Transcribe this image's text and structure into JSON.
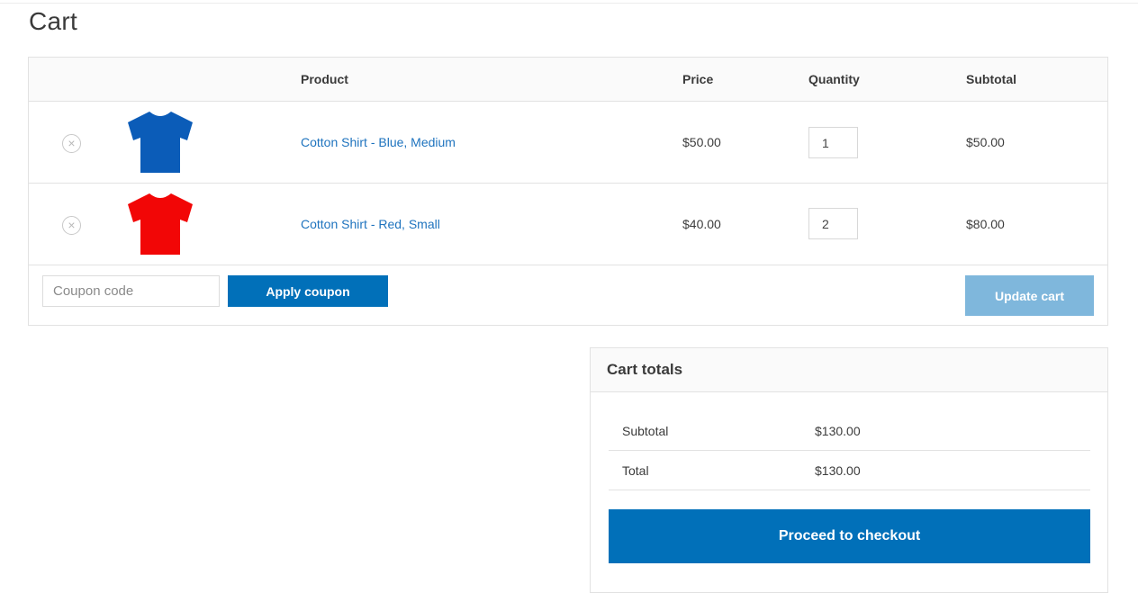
{
  "page": {
    "title": "Cart"
  },
  "cart_table": {
    "headers": {
      "product": "Product",
      "price": "Price",
      "quantity": "Quantity",
      "subtotal": "Subtotal"
    },
    "items": [
      {
        "name": "Cotton Shirt - Blue, Medium",
        "price": "$50.00",
        "quantity": "1",
        "subtotal": "$50.00",
        "shirt_color": "#0b5cb8",
        "remove_icon": "close-circle-icon"
      },
      {
        "name": "Cotton Shirt - Red, Small",
        "price": "$40.00",
        "quantity": "2",
        "subtotal": "$80.00",
        "shirt_color": "#f20606",
        "remove_icon": "close-circle-icon"
      }
    ],
    "remove_glyph": "×"
  },
  "actions": {
    "coupon_placeholder": "Coupon code",
    "apply_coupon_label": "Apply coupon",
    "update_cart_label": "Update cart"
  },
  "cart_totals": {
    "title": "Cart totals",
    "subtotal_label": "Subtotal",
    "subtotal_value": "$130.00",
    "total_label": "Total",
    "total_value": "$130.00",
    "checkout_label": "Proceed to checkout"
  },
  "colors": {
    "primary_button": "#0170b9",
    "disabled_button": "#7fb7dc",
    "link": "#1e73be"
  }
}
